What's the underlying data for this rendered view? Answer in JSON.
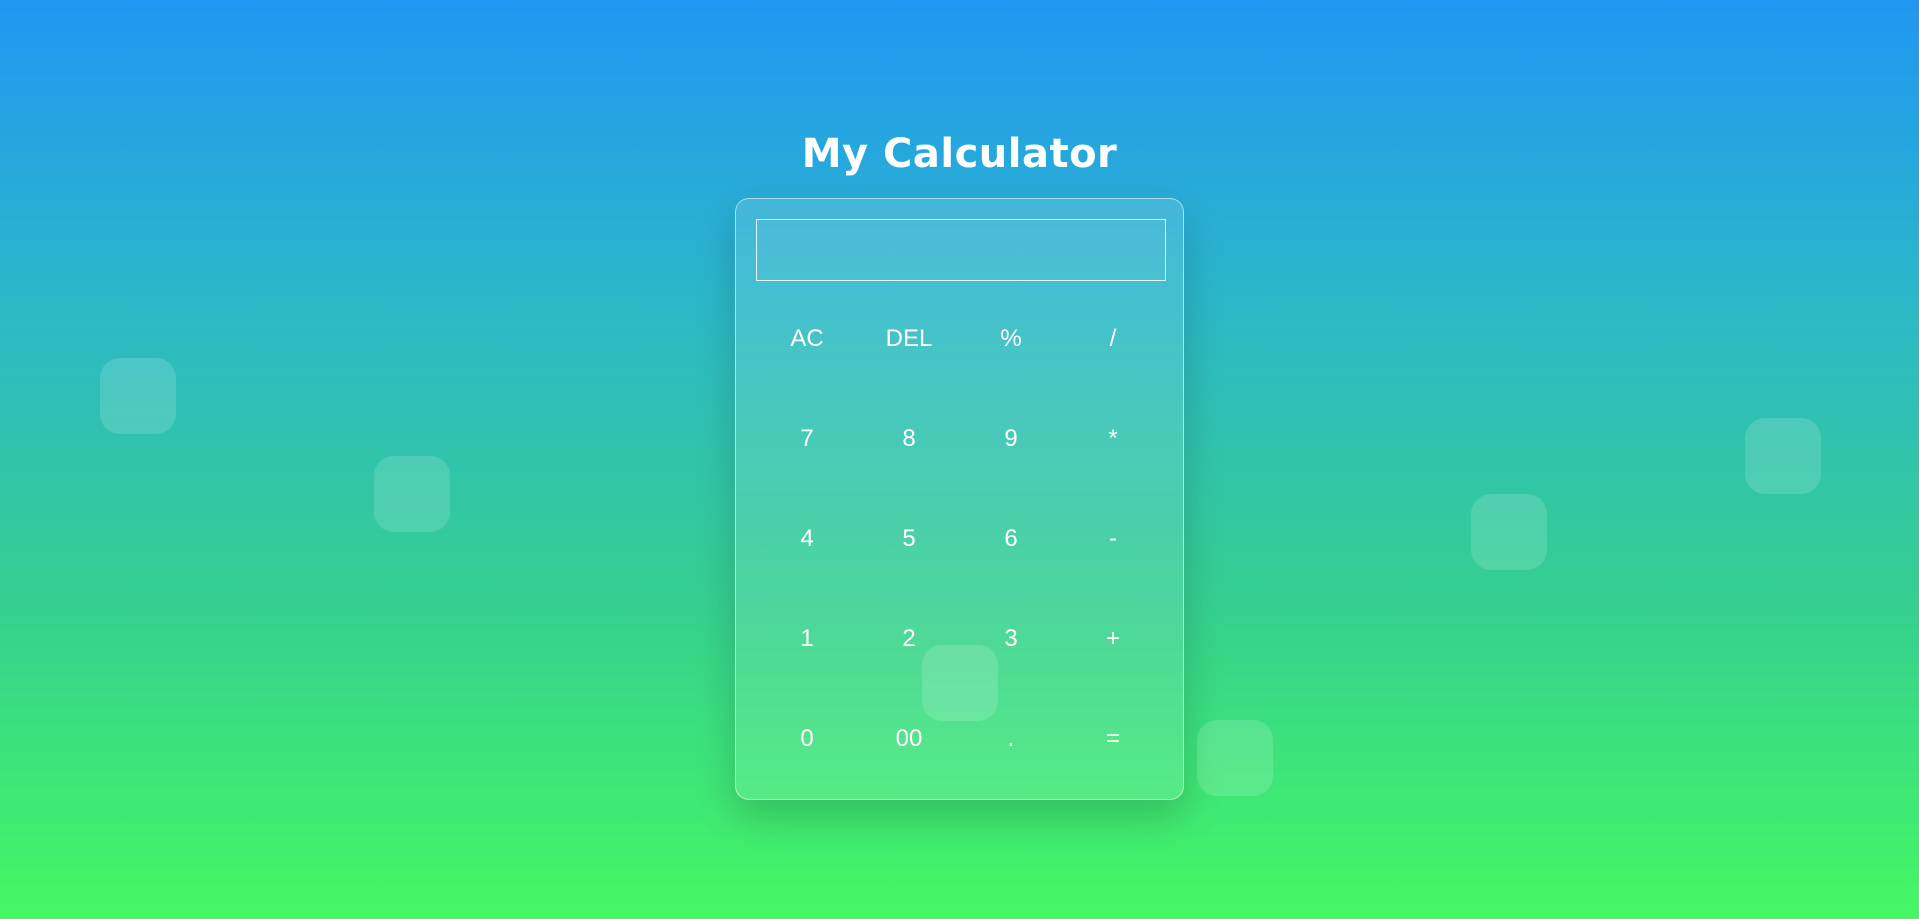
{
  "page": {
    "title": "My Calculator"
  },
  "display": {
    "value": ""
  },
  "keys": [
    {
      "label": "AC",
      "name": "all-clear-button"
    },
    {
      "label": "DEL",
      "name": "delete-button"
    },
    {
      "label": "%",
      "name": "percent-button"
    },
    {
      "label": "/",
      "name": "divide-button"
    },
    {
      "label": "7",
      "name": "digit-7-button"
    },
    {
      "label": "8",
      "name": "digit-8-button"
    },
    {
      "label": "9",
      "name": "digit-9-button"
    },
    {
      "label": "*",
      "name": "multiply-button"
    },
    {
      "label": "4",
      "name": "digit-4-button"
    },
    {
      "label": "5",
      "name": "digit-5-button"
    },
    {
      "label": "6",
      "name": "digit-6-button"
    },
    {
      "label": "-",
      "name": "subtract-button"
    },
    {
      "label": "1",
      "name": "digit-1-button"
    },
    {
      "label": "2",
      "name": "digit-2-button"
    },
    {
      "label": "3",
      "name": "digit-3-button"
    },
    {
      "label": "+",
      "name": "add-button"
    },
    {
      "label": "0",
      "name": "digit-0-button"
    },
    {
      "label": "00",
      "name": "double-zero-button"
    },
    {
      "label": ".",
      "name": "decimal-point-button"
    },
    {
      "label": "=",
      "name": "equals-button"
    }
  ],
  "colors": {
    "gradient_top": "#2196f3",
    "gradient_bottom": "#46f764",
    "text": "#ffffff"
  }
}
